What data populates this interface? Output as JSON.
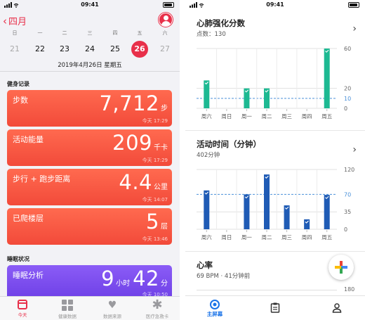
{
  "left": {
    "status": {
      "time": "09:41"
    },
    "back_label": "四月",
    "weekdays": [
      "日",
      "一",
      "二",
      "三",
      "四",
      "五",
      "六"
    ],
    "dates": [
      "21",
      "22",
      "23",
      "24",
      "25",
      "26",
      "27"
    ],
    "selected_date_index": 5,
    "date_title": "2019年4月26日 星期五",
    "fitness_header": "健身记录",
    "cards": [
      {
        "name": "步数",
        "value": "7,712",
        "unit": "步",
        "time": "今天 17:29"
      },
      {
        "name": "活动能量",
        "value": "209",
        "unit": "千卡",
        "time": "今天 17:29"
      },
      {
        "name": "步行 + 跑步距离",
        "value": "4.4",
        "unit": "公里",
        "time": "今天 14:07"
      },
      {
        "name": "已爬楼层",
        "value": "5",
        "unit": "层",
        "time": "今天 13:46"
      }
    ],
    "sleep_header": "睡眠状况",
    "sleep_card": {
      "name": "睡眠分析",
      "hours": "9",
      "hours_unit": "小时",
      "minutes": "42",
      "minutes_unit": "分",
      "time": "今天 10:50"
    },
    "tabs": [
      {
        "label": "今天",
        "icon": "calendar-icon"
      },
      {
        "label": "健康数据",
        "icon": "grid-icon"
      },
      {
        "label": "数据来源",
        "icon": "heart-icon"
      },
      {
        "label": "医疗急救卡",
        "icon": "asterisk-icon"
      }
    ],
    "colors": {
      "accent": "#e8304a",
      "card_orange": "#f24a3a",
      "card_purple": "#6d3fe6"
    }
  },
  "right": {
    "status": {
      "time": "09:41"
    },
    "cardio": {
      "title": "心肺强化分数",
      "subtitle": "点数：130"
    },
    "activity": {
      "title": "活动时间（分钟）",
      "subtitle": "402分钟"
    },
    "heart": {
      "title": "心率",
      "subtitle": "69 BPM · 41分钟前",
      "axis_top": "180"
    },
    "nav": [
      {
        "label": "主屏幕",
        "icon": "home-icon"
      },
      {
        "label": "",
        "icon": "journal-icon"
      },
      {
        "label": "",
        "icon": "profile-icon"
      }
    ],
    "colors": {
      "cardio": "#1db992",
      "activity": "#1f5bb5",
      "target": "#4a90d9",
      "nav": "#1a73e8"
    }
  },
  "chart_data": [
    {
      "type": "bar",
      "categories": [
        "周六",
        "周日",
        "周一",
        "周二",
        "周三",
        "周四",
        "周五"
      ],
      "values": [
        28,
        0,
        20,
        20,
        0,
        0,
        60
      ],
      "yticks": [
        0,
        10,
        20,
        60
      ],
      "target": 10,
      "ylim": [
        0,
        60
      ],
      "grid": true,
      "title": "心肺强化分数",
      "xlabel": "",
      "ylabel": ""
    },
    {
      "type": "bar",
      "categories": [
        "周六",
        "周日",
        "周一",
        "周二",
        "周三",
        "周四",
        "周五"
      ],
      "values": [
        78,
        0,
        70,
        110,
        48,
        20,
        69
      ],
      "yticks": [
        0,
        35,
        70,
        120
      ],
      "target": 70,
      "ylim": [
        0,
        120
      ],
      "grid": true,
      "title": "活动时间（分钟）",
      "xlabel": "",
      "ylabel": ""
    }
  ]
}
